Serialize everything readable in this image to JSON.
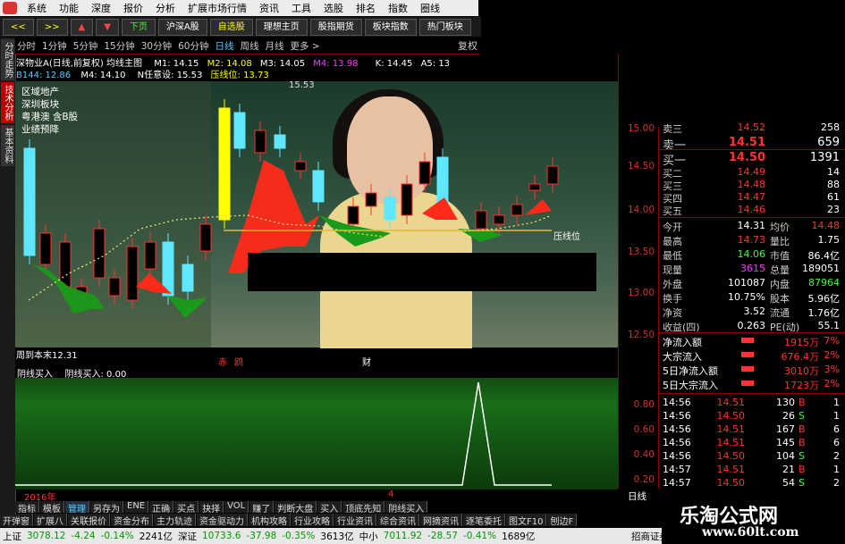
{
  "menu": [
    "系统",
    "功能",
    "深度",
    "报价",
    "分析",
    "扩展市场行情",
    "资讯",
    "工具",
    "选股",
    "排名",
    "指数",
    "圈线"
  ],
  "toolbar": {
    "back": "<<",
    "forward": ">>",
    "up": "▲",
    "down": "▼",
    "xiaye": "下页",
    "b1": "沪深A股",
    "b2": "自选股",
    "b3": "理想主页",
    "b4": "股指期货",
    "b5": "板块指数",
    "b6": "热门板块"
  },
  "periods": [
    "分时",
    "1分钟",
    "5分钟",
    "15分钟",
    "30分钟",
    "60分钟",
    "日线",
    "周线",
    "月线",
    "更多 >"
  ],
  "fuquan": "复权",
  "vtabs": [
    "分时走势",
    "技术分析",
    "基本资料"
  ],
  "chart_header": {
    "name": "深物业A(日线,前复权) 均线主图",
    "m1": "M1: 14.15",
    "m2": "M2: 14.08",
    "m3": "M3: 14.05",
    "m4": "M4: 13.98",
    "k": "K: 14.45",
    "a5": "A5: 13",
    "b144": "B144: 12.86",
    "m4b": "M4: 14.10",
    "nrenyi": "N任意设: 15.53",
    "yaxian": "压线位: 13.73"
  },
  "chart_labels": {
    "info": [
      "区域地产",
      "深圳板块",
      "粤港澳 含B股",
      "业绩预降"
    ],
    "high": "15.53",
    "low": "12.31",
    "low_prefix": "周到本末",
    "yaxianwei": "压线位",
    "chi": "赤",
    "gou": "鸥",
    "cai": "财"
  },
  "indicator": {
    "title": "阴线买入",
    "value": "阴线买入: 0.00"
  },
  "price_axis": [
    "15.00",
    "14.50",
    "14.00",
    "13.50",
    "13.00",
    "12.50"
  ],
  "ind_axis": [
    "0.80",
    "0.60",
    "0.40",
    "0.20"
  ],
  "quote": {
    "sell3": "卖三",
    "sell3_price": "14.52",
    "sell3_vol": "258",
    "sell1": "卖一",
    "sell1_price": "14.51",
    "sell1_vol": "659",
    "buy1": "买一",
    "buy1_price": "14.50",
    "buy1_vol": "1391",
    "buy2": "买二",
    "buy2_price": "14.49",
    "buy2_vol": "14",
    "buy3": "买三",
    "buy3_price": "14.48",
    "buy3_vol": "88",
    "buy4": "买四",
    "buy4_price": "14.47",
    "buy4_vol": "61",
    "buy5": "买五",
    "buy5_price": "14.46",
    "buy5_vol": "23"
  },
  "stats": [
    [
      "今开",
      "14.31",
      "均价",
      "14.48"
    ],
    [
      "最高",
      "14.73",
      "量比",
      "1.75"
    ],
    [
      "最低",
      "14.06",
      "市值",
      "86.4亿"
    ],
    [
      "现量",
      "3615",
      "总量",
      "189051"
    ],
    [
      "外盘",
      "101087",
      "内盘",
      "87964"
    ],
    [
      "换手",
      "10.75%",
      "股本",
      "5.96亿"
    ],
    [
      "净资",
      "3.52",
      "流通",
      "1.76亿"
    ],
    [
      "收益(四)",
      "0.263",
      "PE(动)",
      "55.1"
    ]
  ],
  "flows": [
    [
      "净流入额",
      "1915万",
      "7%"
    ],
    [
      "大宗流入",
      "676.4万",
      "2%"
    ],
    [
      "5日净流入额",
      "3010万",
      "3%"
    ],
    [
      "5日大宗流入",
      "1723万",
      "2%"
    ]
  ],
  "ticks": [
    [
      "14:56",
      "14.51",
      "130",
      "B",
      "1"
    ],
    [
      "14:56",
      "14.50",
      "26",
      "S",
      "1"
    ],
    [
      "14:56",
      "14.51",
      "167",
      "B",
      "6"
    ],
    [
      "14:56",
      "14.51",
      "145",
      "B",
      "6"
    ],
    [
      "14:56",
      "14.50",
      "104",
      "S",
      "2"
    ],
    [
      "14:57",
      "14.51",
      "21",
      "B",
      "1"
    ],
    [
      "14:57",
      "14.50",
      "54",
      "S",
      "2"
    ]
  ],
  "year_label": "2016年",
  "marker4": "4",
  "rixian": "日线",
  "tabs1": [
    "指标",
    "模板",
    "管理",
    "另存为",
    "ENE",
    "正确",
    "买点",
    "抉择",
    "VOL",
    "赚了",
    "判断大盘",
    "买入",
    "顶底先知",
    "阴线买入"
  ],
  "tabs2": [
    "开弹窗",
    "扩展八",
    "关联报价",
    "资金分布",
    "主力轨迹",
    "资金驱动力",
    "机构攻略",
    "行业攻略",
    "行业资讯",
    "综合资讯",
    "网摘资讯",
    "逐笔委托",
    "图文F10",
    "刨边F"
  ],
  "status": {
    "sh": "上证",
    "sh_val": "3078.12",
    "sh_chg": "-4.24",
    "sh_pct": "-0.14%",
    "sh_amt": "2241亿",
    "sz": "深证",
    "sz_val": "10733.6",
    "sz_chg": "-37.98",
    "sz_pct": "-0.35%",
    "sz_amt": "3613亿",
    "zx": "中小",
    "zx_val": "7011.92",
    "zx_chg": "-28.57",
    "zx_pct": "-0.41%",
    "zx_amt": "1689亿",
    "broker": "招商证券"
  },
  "watermark": {
    "title": "乐淘公式网",
    "url": "www.60lt.com"
  },
  "colors": {
    "up": "#ff3333",
    "down": "#33ff33",
    "bg": "#000000",
    "accent": "#55ccff"
  },
  "chart_data": {
    "type": "candlestick",
    "y_axis": [
      12.5,
      15.0
    ],
    "max_label": 15.53,
    "min_label": 12.31,
    "annotations": [
      "压线位"
    ]
  }
}
